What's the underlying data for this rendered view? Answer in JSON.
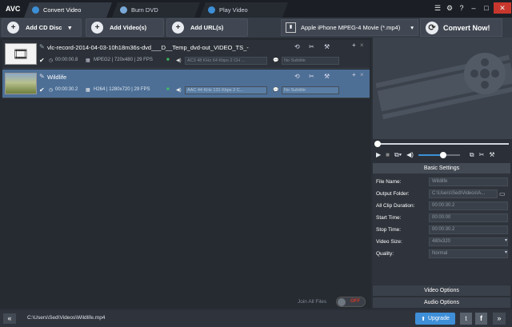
{
  "app": {
    "logo": "AVC"
  },
  "tabs": [
    {
      "label": "Convert Video",
      "active": true
    },
    {
      "label": "Burn DVD",
      "active": false
    },
    {
      "label": "Play Video",
      "active": false
    }
  ],
  "window_controls": {
    "minimize": "–",
    "maximize": "□",
    "close": "✕",
    "help": "?"
  },
  "toolbar": {
    "add_cd": "Add CD Disc",
    "add_video": "Add Video(s)",
    "add_url": "Add URL(s)",
    "profile": "Apple iPhone MPEG-4 Movie (*.mp4)",
    "convert": "Convert Now!"
  },
  "files": [
    {
      "name": "vlc-record-2014-04-03-10h18m36s-dvd___D__Temp_dvd-out_VIDEO_TS_-",
      "duration": "00:00:00.8",
      "codec": "MPEG2 | 720x480 | 29 FPS",
      "audio": "AC3 48 KHz 64 Kbps 2 CH ...",
      "subtitle": "No Subtitle",
      "selected": false
    },
    {
      "name": "Wildlife",
      "duration": "00:00:30.2",
      "codec": "H264 | 1280x720 | 29 FPS",
      "audio": "AAC 44 KHz 131 Kbps 2 C...",
      "subtitle": "No Subtitle",
      "selected": true
    }
  ],
  "join": {
    "label": "Join All Files",
    "state": "OFF"
  },
  "settings": {
    "header": "Basic Settings",
    "rows": [
      {
        "label": "File Name:",
        "value": "Wildlife"
      },
      {
        "label": "Output Folder:",
        "value": "C:\\Users\\Sed\\Videos\\A..."
      },
      {
        "label": "All Clip Duration:",
        "value": "00:00:30.2"
      },
      {
        "label": "Start Time:",
        "value": "00:00:00"
      },
      {
        "label": "Stop Time:",
        "value": "00:00:30.2"
      },
      {
        "label": "Video Size:",
        "value": "480x320"
      },
      {
        "label": "Quality:",
        "value": "Normal"
      }
    ],
    "video_options": "Video Options",
    "audio_options": "Audio Options"
  },
  "status": {
    "path": "C:\\Users\\Sed\\Videos\\Wildlife.mp4",
    "upgrade": "Upgrade",
    "collapse": "«"
  },
  "playback": {
    "progress": 0.0,
    "volume": 0.6
  },
  "colors": {
    "accent": "#3d8fd6",
    "selection": "#4d6f96",
    "close": "#c8372d",
    "upgrade": "#3e8fd8"
  }
}
